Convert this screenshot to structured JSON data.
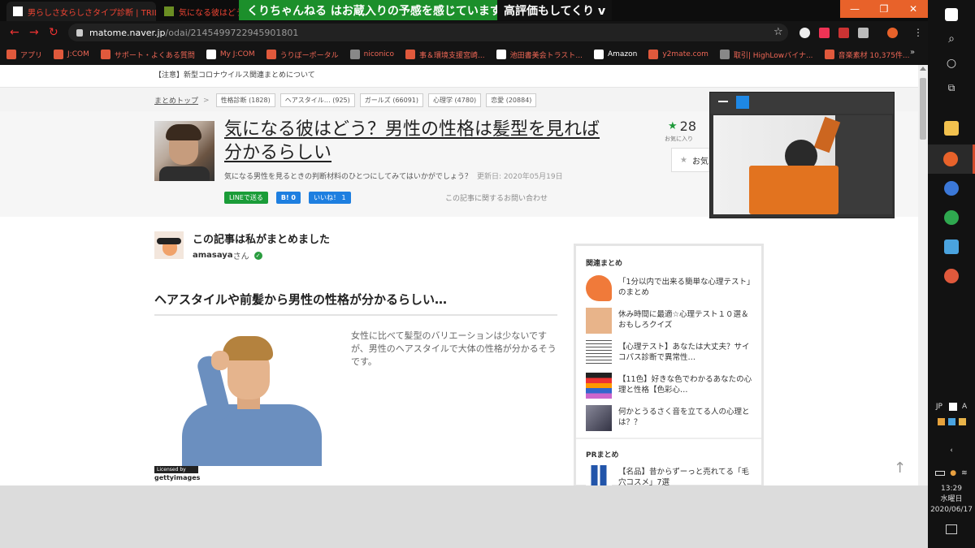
{
  "tabs": [
    {
      "title": "男らしさ女らしさタイプ診断 | TRILL[",
      "close": "✕"
    },
    {
      "title": "気になる彼はどう？"
    }
  ],
  "overlay": {
    "green_text": "くりちゃんねる はお蔵入りの予感を感じています",
    "dark_text": "高評価もしてくり v"
  },
  "window_controls": {
    "minimize": "—",
    "maximize": "❐",
    "close": "✕"
  },
  "address_bar": {
    "host": "matome.naver.jp",
    "path": "/odai/2145499722945901801"
  },
  "bookmarks": [
    {
      "label": "アプリ",
      "icon_color": "#e0593c"
    },
    {
      "label": "J:COM",
      "icon_color": "#e0593c"
    },
    {
      "label": "サポート・よくある質問",
      "icon_color": "#e0593c"
    },
    {
      "label": "My J:COM",
      "icon_color": "#ffffff"
    },
    {
      "label": "うりぼーポータル",
      "icon_color": "#e0593c"
    },
    {
      "label": "niconico",
      "icon_color": "#888888"
    },
    {
      "label": "事＆環境支援宮崎...",
      "icon_color": "#e0593c"
    },
    {
      "label": "池田書美会トラスト...",
      "icon_color": "#ffffff"
    },
    {
      "label": "Amazon",
      "icon_color": "#ffffff"
    },
    {
      "label": "y2mate.com",
      "icon_color": "#e0593c"
    },
    {
      "label": "取引| HighLowバイナ...",
      "icon_color": "#888888"
    },
    {
      "label": "音楽素材 10,375件...",
      "icon_color": "#e0593c"
    }
  ],
  "bookmarks_more": "»",
  "page": {
    "notice": "【注意】新型コロナウイルス関連まとめについて",
    "breadcrumb_home": "まとめトップ",
    "breadcrumb_arrow": ">",
    "tags": [
      "性格診断 (1828)",
      "ヘアスタイル… (925)",
      "ガールズ (66091)",
      "心理学 (4780)",
      "恋愛 (20884)"
    ],
    "title": "気になる彼はどう？男性の性格は髪型を見れば分かるらしい",
    "description": "気になる男性を見るときの判断材料のひとつにしてみてはいかがでしょう？",
    "updated": "更新日: 2020年05月19日",
    "share": {
      "line": "LINEで送る",
      "hatena": "B! 0",
      "facebook": "いいね！ 1"
    },
    "contact": "この記事に関するお問い合わせ",
    "favorites": {
      "count": "28",
      "label": "お気に入り",
      "button": "お気"
    },
    "author": {
      "heading": "この記事は私がまとめました",
      "name": "amasaya",
      "suffix": "さん"
    },
    "section_heading": "ヘアスタイルや前髪から男性の性格が分かるらしい…",
    "body_text": "女性に比べて髪型のバリエーションは少ないですが、男性のヘアスタイルで大体の性格が分かるそうです。",
    "getty": {
      "licensed": "Licensed by",
      "brand": "gettyimages"
    },
    "sidebar": {
      "related_heading": "関連まとめ",
      "related": [
        {
          "text": "「1分以内で出来る簡単な心理テスト」のまとめ",
          "color": "#f07a3a"
        },
        {
          "text": "休み時間に最適☆心理テスト１０選＆おもしろクイズ",
          "color": "#e8b48a"
        },
        {
          "text": "【心理テスト】あなたは大丈夫？サイコパス診断で異常性…",
          "color": "#dddddd"
        },
        {
          "text": "【11色】好きな色でわかるあなたの心理と性格【色彩心…",
          "color": "#4466cc"
        },
        {
          "text": "何かとうるさく音を立てる人の心理とは？？",
          "color": "#8899aa"
        }
      ],
      "pr_heading": "PRまとめ",
      "pr": [
        {
          "text": "【名品】昔からずーっと売れてる「毛穴コスメ」7選",
          "color": "#2255aa"
        }
      ]
    },
    "to_top": "↑"
  },
  "taskbar": {
    "ime": "JP",
    "ime2": "A",
    "clock_time": "13:29",
    "clock_day": "水曜日",
    "clock_date": "2020/06/17"
  },
  "colors": {
    "accent": "#e8622a",
    "green": "#1c8f2b",
    "line_green": "#1a9c38",
    "fb_blue": "#1e7fe0"
  }
}
